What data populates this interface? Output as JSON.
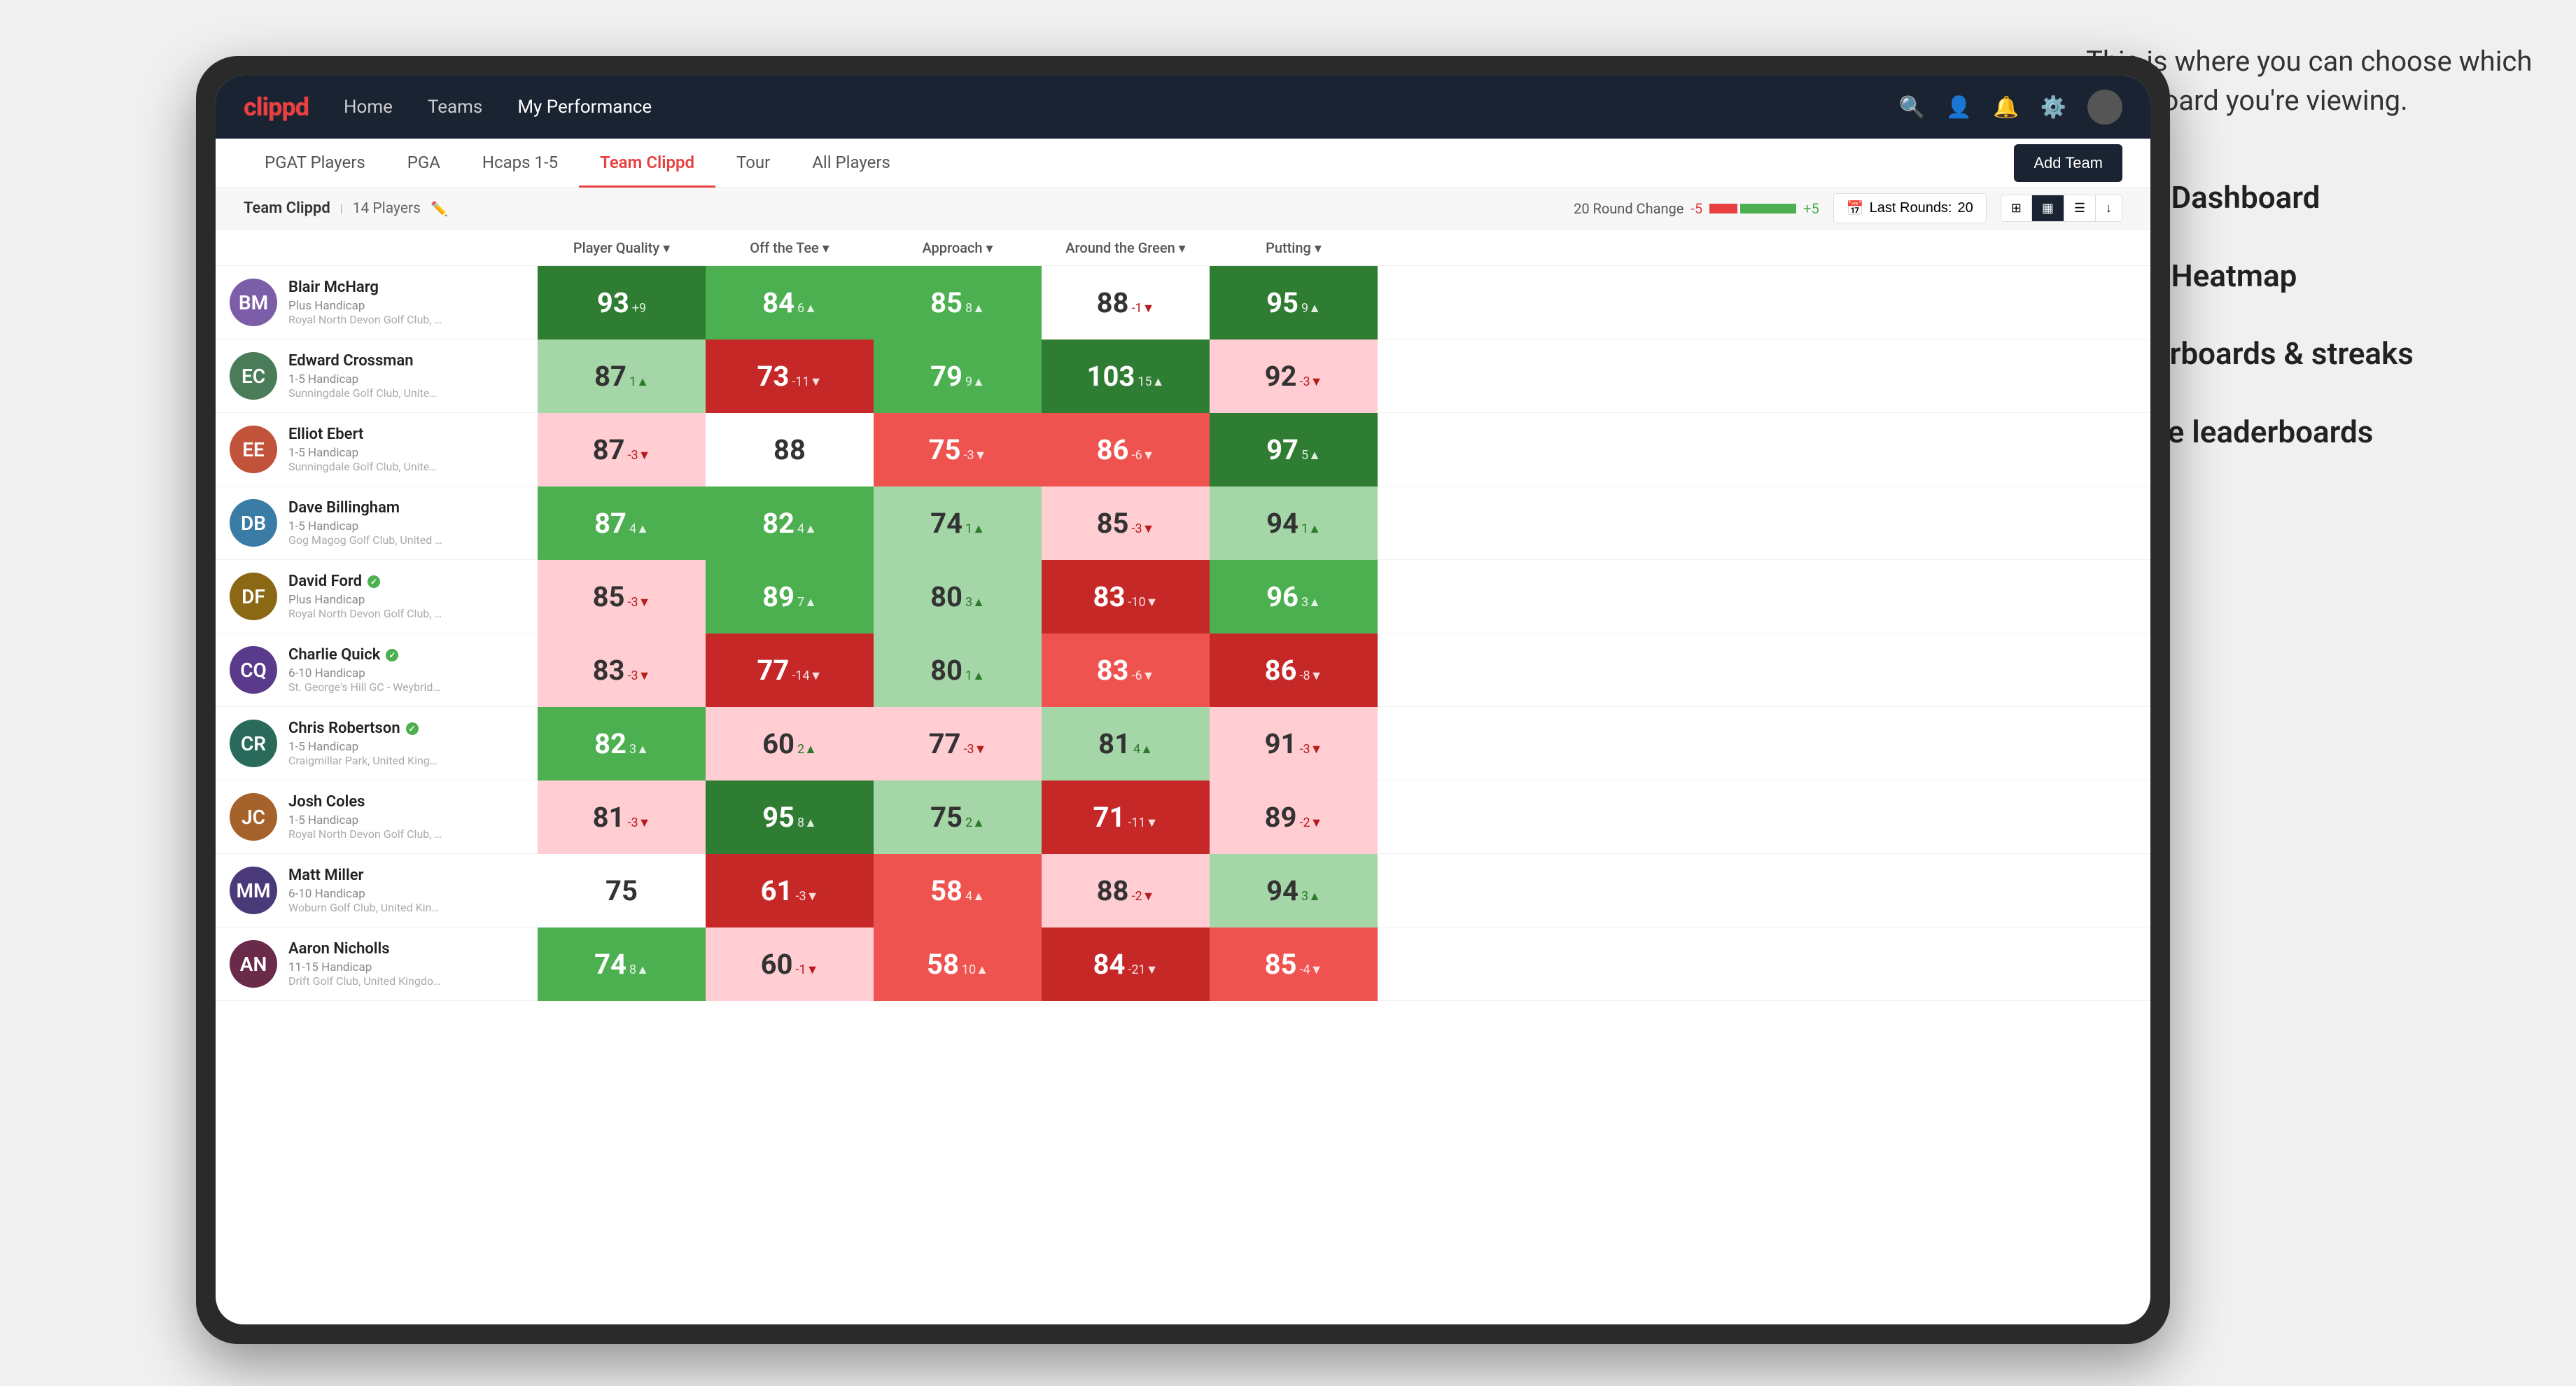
{
  "annotation": {
    "intro": "This is where you can choose which dashboard you're viewing.",
    "items": [
      "Team Dashboard",
      "Team Heatmap",
      "Leaderboards & streaks",
      "Course leaderboards"
    ]
  },
  "navbar": {
    "logo": "clippd",
    "nav_items": [
      "Home",
      "Teams",
      "My Performance"
    ],
    "active_nav": "My Performance"
  },
  "subnav": {
    "tabs": [
      "PGAT Players",
      "PGA",
      "Hcaps 1-5",
      "Team Clippd",
      "Tour",
      "All Players"
    ],
    "active_tab": "Team Clippd",
    "add_button": "Add Team"
  },
  "team_header": {
    "name": "Team Clippd",
    "player_count": "14 Players",
    "round_change_label": "20 Round Change",
    "change_neg": "-5",
    "change_pos": "+5",
    "last_rounds_label": "Last Rounds:",
    "last_rounds_value": "20"
  },
  "columns": {
    "player_quality": "Player Quality ▾",
    "off_the_tee": "Off the Tee ▾",
    "approach": "Approach ▾",
    "around_green": "Around the Green ▾",
    "putting": "Putting ▾"
  },
  "players": [
    {
      "name": "Blair McHarg",
      "handicap": "Plus Handicap",
      "club": "Royal North Devon Golf Club, United Kingdom",
      "color": "#8B6914",
      "initials": "BM",
      "player_quality": {
        "value": 93,
        "change": "+9",
        "dir": "up",
        "bg": "green-dark"
      },
      "off_tee": {
        "value": 84,
        "change": "6▲",
        "dir": "up",
        "bg": "green-mid"
      },
      "approach": {
        "value": 85,
        "change": "8▲",
        "dir": "up",
        "bg": "green-mid"
      },
      "around_green": {
        "value": 88,
        "change": "-1▼",
        "dir": "down",
        "bg": "white"
      },
      "putting": {
        "value": 95,
        "change": "9▲",
        "dir": "up",
        "bg": "green-dark"
      }
    },
    {
      "name": "Edward Crossman",
      "handicap": "1-5 Handicap",
      "club": "Sunningdale Golf Club, United Kingdom",
      "color": "#5a7a5a",
      "initials": "EC",
      "player_quality": {
        "value": 87,
        "change": "1▲",
        "dir": "up",
        "bg": "green-light"
      },
      "off_tee": {
        "value": 73,
        "change": "-11▼",
        "dir": "down",
        "bg": "red-dark"
      },
      "approach": {
        "value": 79,
        "change": "9▲",
        "dir": "up",
        "bg": "green-mid"
      },
      "around_green": {
        "value": 103,
        "change": "15▲",
        "dir": "up",
        "bg": "green-dark"
      },
      "putting": {
        "value": 92,
        "change": "-3▼",
        "dir": "down",
        "bg": "red-light"
      }
    },
    {
      "name": "Elliot Ebert",
      "handicap": "1-5 Handicap",
      "club": "Sunningdale Golf Club, United Kingdom",
      "color": "#7a5a3a",
      "initials": "EE",
      "player_quality": {
        "value": 87,
        "change": "-3▼",
        "dir": "down",
        "bg": "red-light"
      },
      "off_tee": {
        "value": 88,
        "change": "",
        "dir": "none",
        "bg": "white"
      },
      "approach": {
        "value": 75,
        "change": "-3▼",
        "dir": "down",
        "bg": "red-mid"
      },
      "around_green": {
        "value": 86,
        "change": "-6▼",
        "dir": "down",
        "bg": "red-mid"
      },
      "putting": {
        "value": 97,
        "change": "5▲",
        "dir": "up",
        "bg": "green-dark"
      }
    },
    {
      "name": "Dave Billingham",
      "handicap": "1-5 Handicap",
      "club": "Gog Magog Golf Club, United Kingdom",
      "color": "#3a5a7a",
      "initials": "DB",
      "player_quality": {
        "value": 87,
        "change": "4▲",
        "dir": "up",
        "bg": "green-mid"
      },
      "off_tee": {
        "value": 82,
        "change": "4▲",
        "dir": "up",
        "bg": "green-mid"
      },
      "approach": {
        "value": 74,
        "change": "1▲",
        "dir": "up",
        "bg": "green-light"
      },
      "around_green": {
        "value": 85,
        "change": "-3▼",
        "dir": "down",
        "bg": "red-light"
      },
      "putting": {
        "value": 94,
        "change": "1▲",
        "dir": "up",
        "bg": "green-light"
      }
    },
    {
      "name": "David Ford",
      "handicap": "Plus Handicap",
      "club": "Royal North Devon Golf Club, United Kingdom",
      "verified": true,
      "color": "#6a4a2a",
      "initials": "DF",
      "player_quality": {
        "value": 85,
        "change": "-3▼",
        "dir": "down",
        "bg": "red-light"
      },
      "off_tee": {
        "value": 89,
        "change": "7▲",
        "dir": "up",
        "bg": "green-mid"
      },
      "approach": {
        "value": 80,
        "change": "3▲",
        "dir": "up",
        "bg": "green-light"
      },
      "around_green": {
        "value": 83,
        "change": "-10▼",
        "dir": "down",
        "bg": "red-dark"
      },
      "putting": {
        "value": 96,
        "change": "3▲",
        "dir": "up",
        "bg": "green-mid"
      }
    },
    {
      "name": "Charlie Quick",
      "handicap": "6-10 Handicap",
      "club": "St. George's Hill GC - Weybridge, Surrey, Uni...",
      "verified": true,
      "color": "#4a6a3a",
      "initials": "CQ",
      "player_quality": {
        "value": 83,
        "change": "-3▼",
        "dir": "down",
        "bg": "red-light"
      },
      "off_tee": {
        "value": 77,
        "change": "-14▼",
        "dir": "down",
        "bg": "red-dark"
      },
      "approach": {
        "value": 80,
        "change": "1▲",
        "dir": "up",
        "bg": "green-light"
      },
      "around_green": {
        "value": 83,
        "change": "-6▼",
        "dir": "down",
        "bg": "red-mid"
      },
      "putting": {
        "value": 86,
        "change": "-8▼",
        "dir": "down",
        "bg": "red-dark"
      }
    },
    {
      "name": "Chris Robertson",
      "handicap": "1-5 Handicap",
      "club": "Craigmillar Park, United Kingdom",
      "verified": true,
      "color": "#5a3a6a",
      "initials": "CR",
      "player_quality": {
        "value": 82,
        "change": "3▲",
        "dir": "up",
        "bg": "green-mid"
      },
      "off_tee": {
        "value": 60,
        "change": "2▲",
        "dir": "up",
        "bg": "red-light"
      },
      "approach": {
        "value": 77,
        "change": "-3▼",
        "dir": "down",
        "bg": "red-light"
      },
      "around_green": {
        "value": 81,
        "change": "4▲",
        "dir": "up",
        "bg": "green-light"
      },
      "putting": {
        "value": 91,
        "change": "-3▼",
        "dir": "down",
        "bg": "red-light"
      }
    },
    {
      "name": "Josh Coles",
      "handicap": "1-5 Handicap",
      "club": "Royal North Devon Golf Club, United Kingdom",
      "color": "#2a4a6a",
      "initials": "JC",
      "player_quality": {
        "value": 81,
        "change": "-3▼",
        "dir": "down",
        "bg": "red-light"
      },
      "off_tee": {
        "value": 95,
        "change": "8▲",
        "dir": "up",
        "bg": "green-dark"
      },
      "approach": {
        "value": 75,
        "change": "2▲",
        "dir": "up",
        "bg": "green-light"
      },
      "around_green": {
        "value": 71,
        "change": "-11▼",
        "dir": "down",
        "bg": "red-dark"
      },
      "putting": {
        "value": 89,
        "change": "-2▼",
        "dir": "down",
        "bg": "red-light"
      }
    },
    {
      "name": "Matt Miller",
      "handicap": "6-10 Handicap",
      "club": "Woburn Golf Club, United Kingdom",
      "color": "#6a2a4a",
      "initials": "MM",
      "player_quality": {
        "value": 75,
        "change": "",
        "dir": "none",
        "bg": "white"
      },
      "off_tee": {
        "value": 61,
        "change": "-3▼",
        "dir": "down",
        "bg": "red-dark"
      },
      "approach": {
        "value": 58,
        "change": "4▲",
        "dir": "up",
        "bg": "red-mid"
      },
      "around_green": {
        "value": 88,
        "change": "-2▼",
        "dir": "down",
        "bg": "red-light"
      },
      "putting": {
        "value": 94,
        "change": "3▲",
        "dir": "up",
        "bg": "green-light"
      }
    },
    {
      "name": "Aaron Nicholls",
      "handicap": "11-15 Handicap",
      "club": "Drift Golf Club, United Kingdom",
      "color": "#3a6a2a",
      "initials": "AN",
      "player_quality": {
        "value": 74,
        "change": "8▲",
        "dir": "up",
        "bg": "green-mid"
      },
      "off_tee": {
        "value": 60,
        "change": "-1▼",
        "dir": "down",
        "bg": "red-light"
      },
      "approach": {
        "value": 58,
        "change": "10▲",
        "dir": "up",
        "bg": "red-mid"
      },
      "around_green": {
        "value": 84,
        "change": "-21▼",
        "dir": "down",
        "bg": "red-dark"
      },
      "putting": {
        "value": 85,
        "change": "-4▼",
        "dir": "down",
        "bg": "red-mid"
      }
    }
  ]
}
